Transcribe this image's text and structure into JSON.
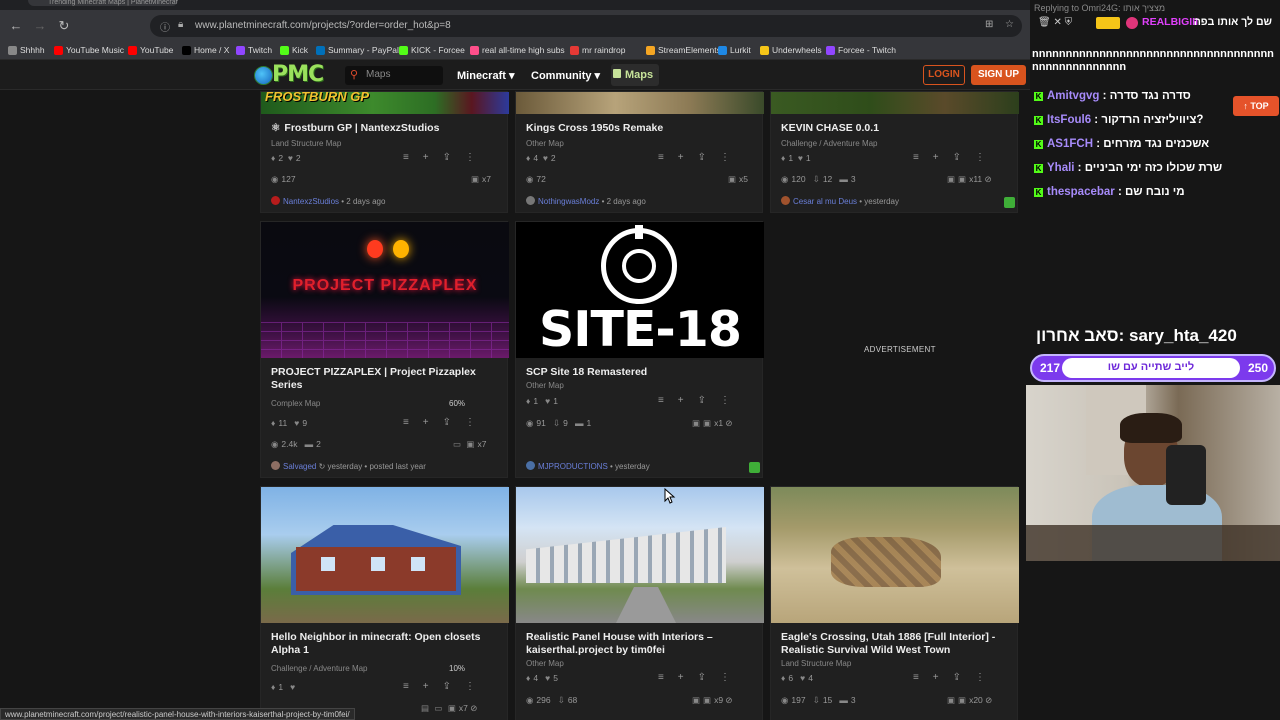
{
  "browser": {
    "tab_title": "Trending Minecraft Maps | PlanetMinecraft",
    "url": "www.planetminecraft.com/projects/?order=order_hot&p=8",
    "bookmarks": [
      {
        "label": "Shhhh",
        "color": "#888888"
      },
      {
        "label": "YouTube Music",
        "color": "#ff0000"
      },
      {
        "label": "YouTube",
        "color": "#ff0000"
      },
      {
        "label": "Home / X",
        "color": "#000000"
      },
      {
        "label": "Twitch",
        "color": "#9146ff"
      },
      {
        "label": "Kick",
        "color": "#53fc18"
      },
      {
        "label": "Summary - PayPal",
        "color": "#0070ba"
      },
      {
        "label": "KICK - Forcee",
        "color": "#53fc18"
      },
      {
        "label": "real all-time high subs",
        "color": "#ff4f8b"
      },
      {
        "label": "mr raindrop",
        "color": "#e53935"
      },
      {
        "label": "StreamElements -",
        "color": "#f5a623"
      },
      {
        "label": "Lurkit",
        "color": "#1e88e5"
      },
      {
        "label": "Underwheels",
        "color": "#f5c518"
      },
      {
        "label": "Forcee - Twitch",
        "color": "#9146ff"
      }
    ]
  },
  "site": {
    "logo": "PMC",
    "search_placeholder": "Maps",
    "nav": {
      "minecraft": "Minecraft ▾",
      "community": "Community ▾",
      "maps": "Maps"
    },
    "login": "LOGIN",
    "signup": "SIGN UP",
    "advertisement": "ADVERTISEMENT"
  },
  "cards": [
    {
      "title": "Frostburn GP | NantexzStudios",
      "category": "Land Structure Map",
      "diamonds": "2",
      "hearts": "2",
      "views": "127",
      "images": "x7",
      "author": "NantexzStudios",
      "time": "2 days ago",
      "thumb_text": "FROSTBURN GP"
    },
    {
      "title": "Kings Cross 1950s Remake",
      "category": "Other Map",
      "diamonds": "4",
      "hearts": "2",
      "views": "72",
      "images": "x5",
      "author": "NothingwasModz",
      "time": "2 days ago"
    },
    {
      "title": "KEVIN CHASE 0.0.1",
      "category": "Challenge / Adventure Map",
      "diamonds": "1",
      "hearts": "1",
      "views": "120",
      "downloads": "12",
      "comments": "3",
      "images": "x11",
      "author": "Cesar al mu Deus",
      "time": "yesterday"
    },
    {
      "title": "PROJECT PIZZAPLEX | Project Pizzaplex Series",
      "category": "Complex Map",
      "progress": "60%",
      "diamonds": "11",
      "hearts": "9",
      "views": "2.4k",
      "comments": "2",
      "images": "x7",
      "author": "Salvaged",
      "time": "yesterday • posted last year",
      "thumb_text": "PROJECT PIZZAPLEX"
    },
    {
      "title": "SCP Site 18 Remastered",
      "category": "Other Map",
      "diamonds": "1",
      "hearts": "1",
      "views": "91",
      "downloads": "9",
      "comments": "1",
      "images": "x1",
      "author": "MJPRODUCTIONS",
      "time": "yesterday",
      "thumb_text": "SITE-18"
    },
    {
      "title": "Hello Neighbor in minecraft: Open closets Alpha 1",
      "category": "Challenge / Adventure Map",
      "progress": "10%",
      "diamonds": "1",
      "hearts": "",
      "images": "x7"
    },
    {
      "title": "Realistic Panel House with Interiors – kaiserthal.project by tim0fei",
      "category": "Other Map",
      "diamonds": "4",
      "hearts": "5",
      "views": "296",
      "downloads": "68",
      "images": "x9"
    },
    {
      "title": "Eagle's Crossing, Utah 1886 [Full Interior] - Realistic Survival Wild West Town",
      "category": "Land Structure Map",
      "diamonds": "6",
      "hearts": "4",
      "views": "197",
      "downloads": "15",
      "comments": "3",
      "images": "x20"
    }
  ],
  "status_url": "www.planetminecraft.com/project/realistic-panel-house-with-interiors-kaiserthal-project-by-tim0fei/",
  "stream": {
    "reply": "Replying to Omri24G: מצציך אותו",
    "top_user": "REALBIGIII",
    "top_msg": "שם לך אותו בפה",
    "chat_wrap": "nnnnnnnnnnnnnnnnnnnnnnnnnnnnnnnnnnnnnnnnnnnnnnnnnn",
    "messages": [
      {
        "user": "Amitvgvg",
        "text": "סדרה נגד סדרה"
      },
      {
        "user": "ItsFoul6",
        "text": "ציוויליזציה הרדקור?"
      },
      {
        "user": "AS1FCH",
        "text": "אשכנזים נגד מזרחים"
      },
      {
        "user": "Yhali",
        "text": "שרת שכולו כזה ימי הביניים"
      },
      {
        "user": "thespacebar",
        "text": "מי נובח שם"
      }
    ],
    "top_button": "↑ TOP",
    "last_sub": "סאב אחרון: sary_hta_420",
    "goal_current": "217",
    "goal_target": "250",
    "goal_label": "לייב שתייה עם שו"
  }
}
